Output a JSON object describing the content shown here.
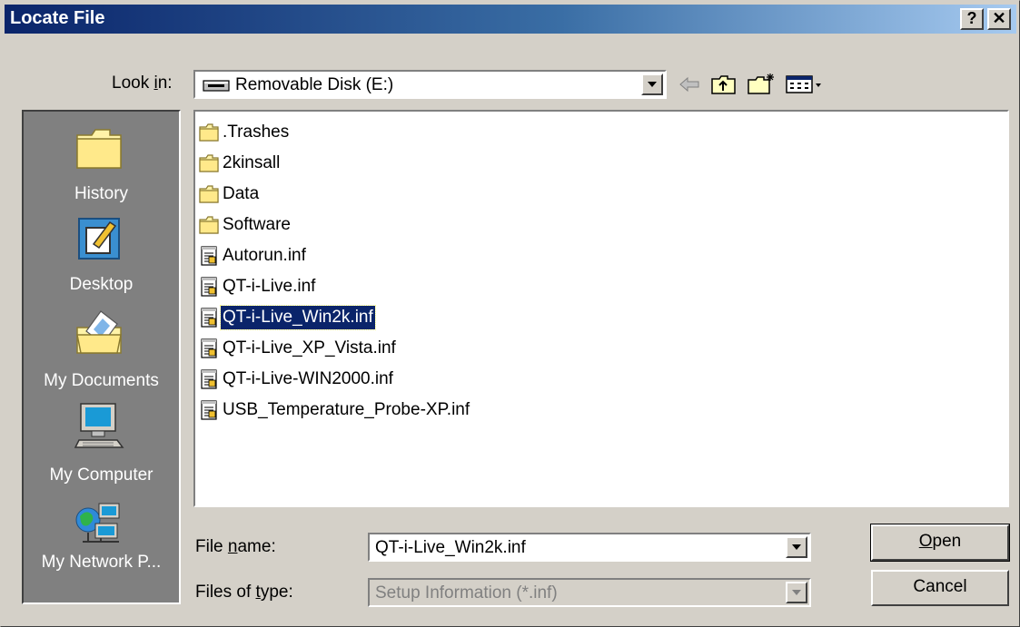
{
  "window": {
    "title": "Locate File",
    "help_button": "?",
    "close_button": "✕"
  },
  "look_in": {
    "label_pre": "Look ",
    "label_key": "i",
    "label_post": "n:",
    "value": "Removable Disk (E:)"
  },
  "toolbar": {
    "back_icon": "back-arrow-icon",
    "up_icon": "up-folder-icon",
    "new_folder_icon": "new-folder-icon",
    "view_icon": "view-menu-icon"
  },
  "places": [
    {
      "label": "History",
      "icon": "history-folder-icon"
    },
    {
      "label": "Desktop",
      "icon": "desktop-icon"
    },
    {
      "label": "My Documents",
      "icon": "my-documents-icon"
    },
    {
      "label": "My Computer",
      "icon": "my-computer-icon"
    },
    {
      "label": "My Network P...",
      "icon": "my-network-places-icon"
    }
  ],
  "files": [
    {
      "name": ".Trashes",
      "type": "folder"
    },
    {
      "name": "2kinsall",
      "type": "folder"
    },
    {
      "name": "Data",
      "type": "folder"
    },
    {
      "name": "Software",
      "type": "folder"
    },
    {
      "name": "Autorun.inf",
      "type": "inf"
    },
    {
      "name": "QT-i-Live.inf",
      "type": "inf"
    },
    {
      "name": "QT-i-Live_Win2k.inf",
      "type": "inf",
      "selected": true
    },
    {
      "name": "QT-i-Live_XP_Vista.inf",
      "type": "inf"
    },
    {
      "name": "QT-i-Live-WIN2000.inf",
      "type": "inf"
    },
    {
      "name": "USB_Temperature_Probe-XP.inf",
      "type": "inf"
    }
  ],
  "file_name": {
    "label_pre": "File ",
    "label_key": "n",
    "label_post": "ame:",
    "value": "QT-i-Live_Win2k.inf"
  },
  "file_type": {
    "label_pre": "Files of ",
    "label_key": "t",
    "label_post": "ype:",
    "value": "Setup Information (*.inf)"
  },
  "buttons": {
    "open_key": "O",
    "open_rest": "pen",
    "cancel": "Cancel"
  },
  "colors": {
    "face": "#d4d0c8",
    "title_start": "#0a246a",
    "title_end": "#a6caf0",
    "selection": "#0a246a",
    "places_bg": "#808080"
  }
}
